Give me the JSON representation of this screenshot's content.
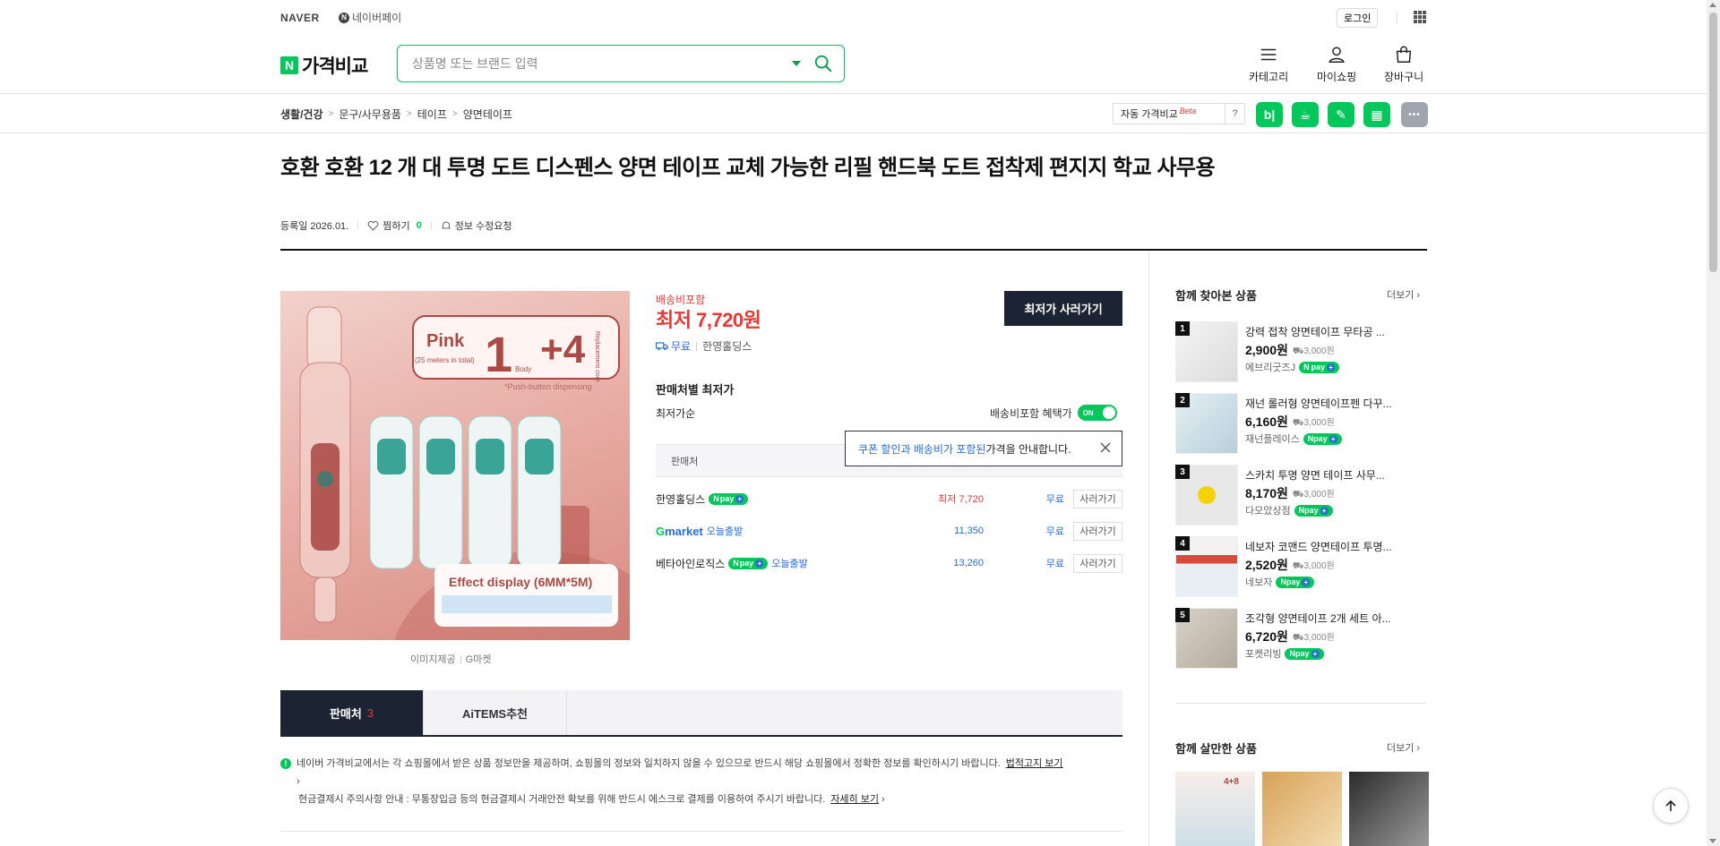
{
  "top": {
    "naver_logo": "NAVER",
    "npay_label": "네이버페이",
    "login_label": "로그인"
  },
  "header": {
    "brand_badge": "N",
    "brand_name": "가격비교",
    "search_placeholder": "상품명 또는 브랜드 입력",
    "nav": [
      {
        "label": "카테고리",
        "icon": "menu-icon"
      },
      {
        "label": "마이쇼핑",
        "icon": "user-icon"
      },
      {
        "label": "장바구니",
        "icon": "cart-icon"
      }
    ]
  },
  "breadcrumb": [
    "생활/건강",
    "문구/사무용품",
    "테이프",
    "양면테이프"
  ],
  "auto_compare": {
    "label": "자동 가격비교",
    "beta": "Beta",
    "help": "?"
  },
  "share": [
    {
      "name": "blog-share-icon",
      "glyph": "b|",
      "color": "#03c75a"
    },
    {
      "name": "cafe-share-icon",
      "glyph": "☕",
      "color": "#03c75a"
    },
    {
      "name": "band-share-icon",
      "glyph": "✎",
      "color": "#03c75a"
    },
    {
      "name": "calendar-share-icon",
      "glyph": "▦",
      "color": "#03c75a"
    },
    {
      "name": "more-share-icon",
      "glyph": "•••",
      "color": "#a0a5b0"
    }
  ],
  "product": {
    "title": "호환 호환 12 개 대 투명 도트 디스펜스 양면 테이프 교체 가능한 리필 핸드북 도트 접착제 편지지 학교 사무용",
    "registered": "등록일 2026.01.",
    "wish_label": "찜하기",
    "wish_count": "0",
    "report_label": "정보 수정요청",
    "img_credit_label": "이미지제공",
    "img_credit_source": "G마켓",
    "img": {
      "pink": "Pink",
      "pink_sub": "(25 meters in total)",
      "one": "1",
      "body": "Body",
      "plus_four": "+4",
      "replacement": "Replacement core",
      "push_text": "*Push-button dispensing",
      "effect": "Effect display (6MM*5M)"
    }
  },
  "price": {
    "ship_note": "배송비포함",
    "lowest_label": "최저",
    "lowest_value": "7,720원",
    "free_label": "무료",
    "mall": "한영홀딩스",
    "buy_label": "최저가 사러가기"
  },
  "sellers_section": {
    "title": "판매처별 최저가",
    "sort_label": "최저가순",
    "ship_toggle_label": "배송비포함 혜택가",
    "toggle_value": "ON",
    "head_label": "판매처",
    "tooltip_blue": "쿠폰 할인과 배송비가 포함된",
    "tooltip_rest": " 가격을 안내합니다.",
    "rows": [
      {
        "name": "한영홀딩스",
        "npay": true,
        "tomorrow": "",
        "price": "최저 7,720",
        "fee": "무료",
        "go": "사러가기"
      },
      {
        "name": "",
        "gmarket": true,
        "npay": false,
        "tomorrow": "오늘출발",
        "price": "11,350",
        "fee": "무료",
        "go": "사러가기"
      },
      {
        "name": "베타아인로직스",
        "npay": true,
        "tomorrow": "오늘출발",
        "price": "13,260",
        "fee": "무료",
        "go": "사러가기"
      }
    ],
    "gmarket_g": "G",
    "gmarket_rest": "market",
    "npay_text": "pay"
  },
  "tabs": [
    {
      "label": "판매처",
      "count": "3"
    },
    {
      "label": "AiTEMS추천",
      "count": ""
    }
  ],
  "notice": {
    "line1": "네이버 가격비교에서는 각 쇼핑몰에서 받은 상품 정보만을 제공하며, 쇼핑몰의 정보와 일치하지 않을 수 있으므로 반드시 해당 쇼핑몰에서 정확한 정보를 확인하시기 바랍니다.",
    "link1": "법적고지 보기",
    "line2": "현금결제시 주의사항 안내 : 무통장입금 등의 현금결제시 거래안전 확보를 위해 반드시 에스크로 결제를 이용하여 주시기 바랍니다.",
    "link2": "자세히 보기"
  },
  "sidebar": {
    "viewed_title": "함께 찾아본 상품",
    "more_label": "더보기",
    "viewed": [
      {
        "rank": "1",
        "name": "강력 접착 양면테이프 무타공 ...",
        "price": "2,900원",
        "ship": "3,000원",
        "mall": "에브리굿즈J"
      },
      {
        "rank": "2",
        "name": "재넌 롤러형 양면테이프펜 다꾸...",
        "price": "6,160원",
        "ship": "3,000원",
        "mall": "재넌플레이스"
      },
      {
        "rank": "3",
        "name": "스카치 투명 양면 테이프 사무...",
        "price": "8,170원",
        "ship": "3,000원",
        "mall": "다모았상점"
      },
      {
        "rank": "4",
        "name": "네보자 코맨드 양면테이프 투명...",
        "price": "2,520원",
        "ship": "3,000원",
        "mall": "네보자"
      },
      {
        "rank": "5",
        "name": "조각형 양면테이프 2개 세트 아...",
        "price": "6,720원",
        "ship": "3,000원",
        "mall": "포켓리빙"
      }
    ],
    "bought_title": "함께 살만한 상품",
    "bought_more": "더보기",
    "bought_thumb_text": "4+8"
  }
}
